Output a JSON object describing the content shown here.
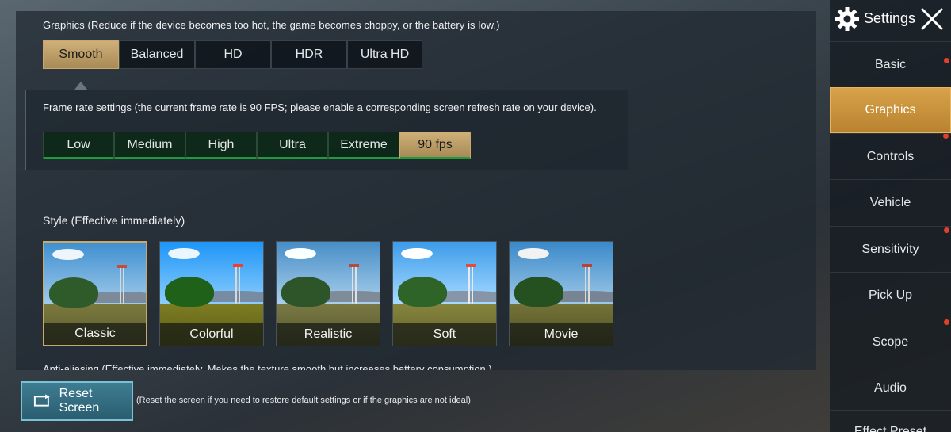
{
  "graphics": {
    "title": "Graphics (Reduce if the device becomes too hot, the game becomes choppy, or the battery is low.)",
    "options": [
      "Smooth",
      "Balanced",
      "HD",
      "HDR",
      "Ultra HD"
    ],
    "selected": "Smooth"
  },
  "frame_rate": {
    "title": "Frame rate settings (the current frame rate is 90 FPS; please enable a corresponding screen refresh rate on your device).",
    "options": [
      "Low",
      "Medium",
      "High",
      "Ultra",
      "Extreme",
      "90 fps"
    ],
    "selected": "90 fps"
  },
  "style": {
    "title": "Style (Effective immediately)",
    "options": [
      "Classic",
      "Colorful",
      "Realistic",
      "Soft",
      "Movie"
    ],
    "selected": "Classic"
  },
  "anti_aliasing": {
    "title_partial": "Anti-aliasing (Effective immediately. Makes the texture smooth but increases battery consumption.)"
  },
  "reset": {
    "button_label": "Reset Screen",
    "note": "(Reset the screen if you need to restore default settings or if the graphics are not ideal)"
  },
  "sidebar": {
    "title": "Settings",
    "items": [
      {
        "label": "Basic",
        "dot": true
      },
      {
        "label": "Graphics",
        "dot": true,
        "active": true
      },
      {
        "label": "Controls",
        "dot": false
      },
      {
        "label": "Vehicle",
        "dot": false
      },
      {
        "label": "Sensitivity",
        "dot": true
      },
      {
        "label": "Pick Up",
        "dot": false
      },
      {
        "label": "Scope",
        "dot": true
      },
      {
        "label": "Audio",
        "dot": false
      },
      {
        "label": "Effect Preset",
        "dot": false
      }
    ]
  },
  "colors": {
    "accent_gold": "#c9a86a",
    "sidebar_active": "#d8a24a",
    "frame_green": "#1f9b3c",
    "reset_blue": "#3e7d92",
    "notification_dot": "#e0402a"
  }
}
